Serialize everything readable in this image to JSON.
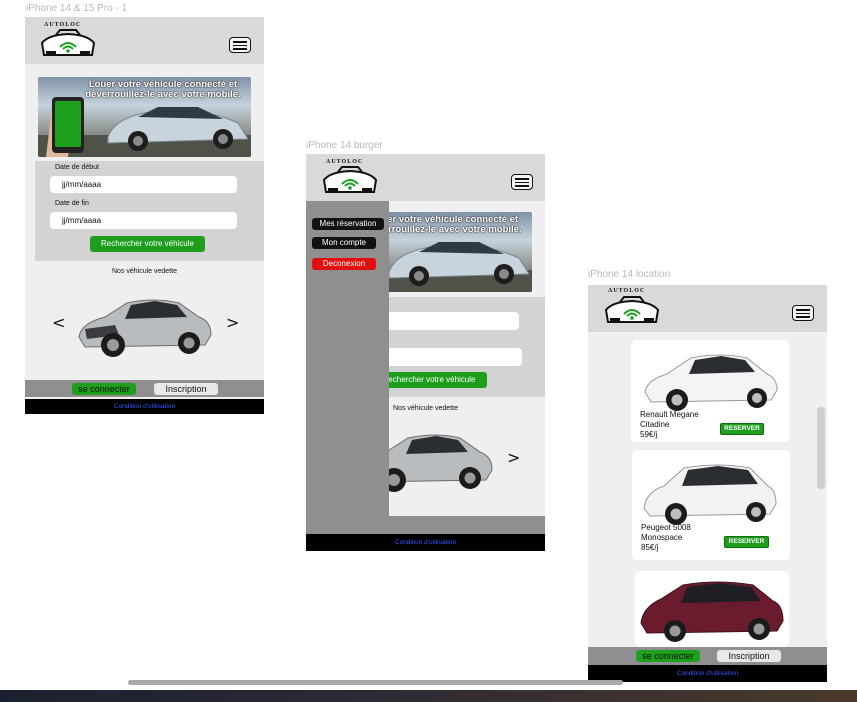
{
  "frames": {
    "home_label": "iPhone 14 & 15 Pro - 1",
    "burger_label": "iPhone 14 burger",
    "location_label": "iPhone 14 location"
  },
  "brand": {
    "logo_text": "AUTOLOC"
  },
  "home": {
    "banner_text": "Louer votre véhicule connecté et déverrouillez-le avec votre mobile.",
    "start_label": "Date de début",
    "start_value": "jj/mm/aaaa",
    "end_label": "Date de fin",
    "end_value": "jj/mm/aaaa",
    "search_button": "Rechercher votre véhicule",
    "featured_title": "Nos véhicule vedette",
    "prev_arrow": "<",
    "next_arrow": ">"
  },
  "burger": {
    "menu_items": [
      "Mes réservation",
      "Mon compte",
      "Deconexion"
    ],
    "banner_text": "Louer votre véhicule connecté et déverrouillez-le avec votre mobile.",
    "search_button": "Rechercher votre véhicule",
    "featured_title": "Nos véhicule vedette",
    "next_arrow": ">",
    "legal": "Condition d'utilisation"
  },
  "location": {
    "cars": [
      {
        "line1": "Renault Megane",
        "line2": "Citadine",
        "price": "59€/j",
        "action": "RESERVER"
      },
      {
        "line1": "Peugeot 5008",
        "line2": "Monospace",
        "price": "85€/j",
        "action": "RESERVER"
      },
      {
        "line1": "",
        "line2": "",
        "price": "",
        "action": ""
      }
    ]
  },
  "footer": {
    "connect": "se connecter",
    "signup": "Inscription",
    "legal": "Condition d'utilisation"
  },
  "colors": {
    "accent_green": "#1d9e1d",
    "header_gray": "#d9d9d9",
    "footer_gray": "#8f8f8f",
    "logout_red": "#e01010",
    "legal_blue": "#3b57ff"
  }
}
